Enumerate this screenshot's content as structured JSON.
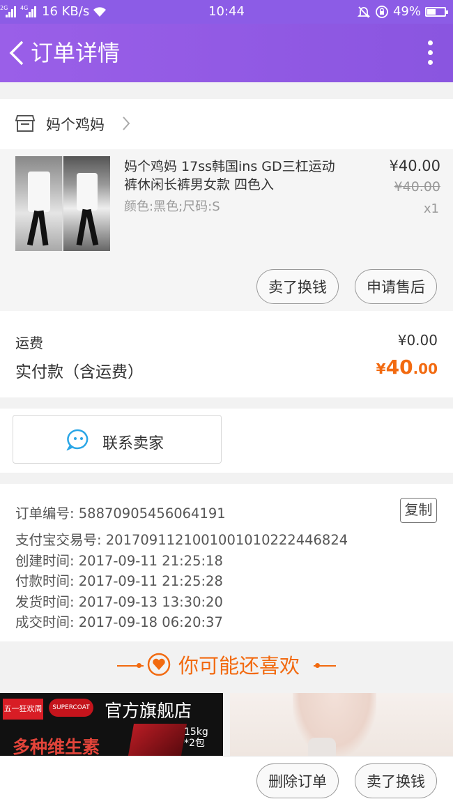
{
  "status_bar": {
    "net1": "2G",
    "net2": "4G",
    "speed": "16 KB/s",
    "time": "10:44",
    "battery": "49%",
    "battery_level": 0.49
  },
  "header": {
    "title": "订单详情"
  },
  "shop": {
    "name": "妈个鸡妈"
  },
  "product": {
    "title": "妈个鸡妈 17ss韩国ins GD三杠运动裤休闲长裤男女款 四色入",
    "attributes": "颜色:黑色;尺码:S",
    "price": "¥40.00",
    "original_price": "¥40.00",
    "quantity": "x1",
    "buttons": [
      "卖了换钱",
      "申请售后"
    ]
  },
  "totals": {
    "shipping_label": "运费",
    "shipping_value": "¥0.00",
    "paid_label": "实付款（含运费）",
    "paid_symbol": "¥",
    "paid_integer": "40",
    "paid_decimal": ".00"
  },
  "contact": {
    "label": "联系卖家"
  },
  "order_info": {
    "copy_label": "复制",
    "lines": [
      "订单编号: 588709054560641​91",
      "支付宝交易号: 2017091121001001010222446824",
      "创建时间: 2017-09-11 21:25:18",
      "付款时间: 2017-09-11 21:25:28",
      "发货时间: 2017-09-13 13:30:20",
      "成交时间: 2017-09-18 06:20:37"
    ]
  },
  "recommend": {
    "title": "你可能还喜欢"
  },
  "ads": {
    "ad1": {
      "badge": "五一狂欢周",
      "brand": "SUPERCOAT",
      "store": "官方旗舰店",
      "tagline": "多种维生素",
      "weight": "15kg",
      "packs": "*2包"
    }
  },
  "bottom_bar": {
    "delete_label": "删除订单",
    "sell_label": "卖了换钱"
  },
  "colors": {
    "header": "#9a5fe8",
    "accent_orange": "#f26a10",
    "chat_blue": "#2aa6e6"
  }
}
